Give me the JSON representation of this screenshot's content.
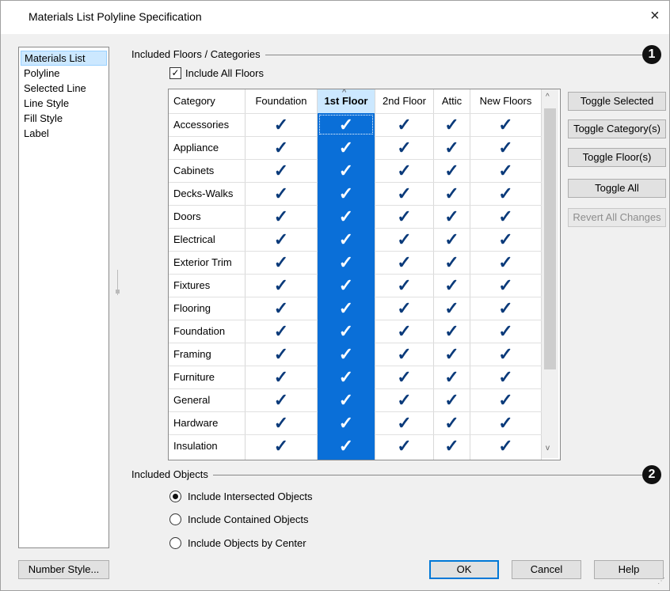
{
  "window": {
    "title": "Materials List Polyline Specification",
    "close_glyph": "×"
  },
  "sidebar": {
    "items": [
      {
        "label": "Materials List",
        "selected": true
      },
      {
        "label": "Polyline"
      },
      {
        "label": "Selected Line"
      },
      {
        "label": "Line Style"
      },
      {
        "label": "Fill Style"
      },
      {
        "label": "Label"
      }
    ]
  },
  "floors_group": {
    "label": "Included Floors / Categories",
    "badge": "1"
  },
  "include_all_floors": {
    "label": "Include All Floors",
    "checked": true,
    "glyph": "✓"
  },
  "table": {
    "columns": [
      "Category",
      "Foundation",
      "1st Floor",
      "2nd Floor",
      "Attic",
      "New Floors"
    ],
    "sorted_column": "1st Floor",
    "check_glyph": "✓",
    "rows": [
      "Accessories",
      "Appliance",
      "Cabinets",
      "Decks-Walks",
      "Doors",
      "Electrical",
      "Exterior Trim",
      "Fixtures",
      "Flooring",
      "Foundation",
      "Framing",
      "Furniture",
      "General",
      "Hardware",
      "Insulation"
    ],
    "selected_column_color": "#0a6fd8"
  },
  "side_buttons": {
    "toggle_selected": "Toggle Selected",
    "toggle_category": "Toggle Category(s)",
    "toggle_floor": "Toggle Floor(s)",
    "toggle_all": "Toggle All",
    "revert_all": "Revert All Changes"
  },
  "objects_group": {
    "label": "Included Objects",
    "badge": "2"
  },
  "radios": [
    {
      "label": "Include Intersected Objects",
      "checked": true
    },
    {
      "label": "Include Contained Objects",
      "checked": false
    },
    {
      "label": "Include Objects by Center",
      "checked": false
    }
  ],
  "footer": {
    "number_style": "Number Style...",
    "ok": "OK",
    "cancel": "Cancel",
    "help": "Help"
  },
  "icons": {
    "sort_up": "^",
    "scroll_up": "^",
    "scroll_down": "v"
  }
}
